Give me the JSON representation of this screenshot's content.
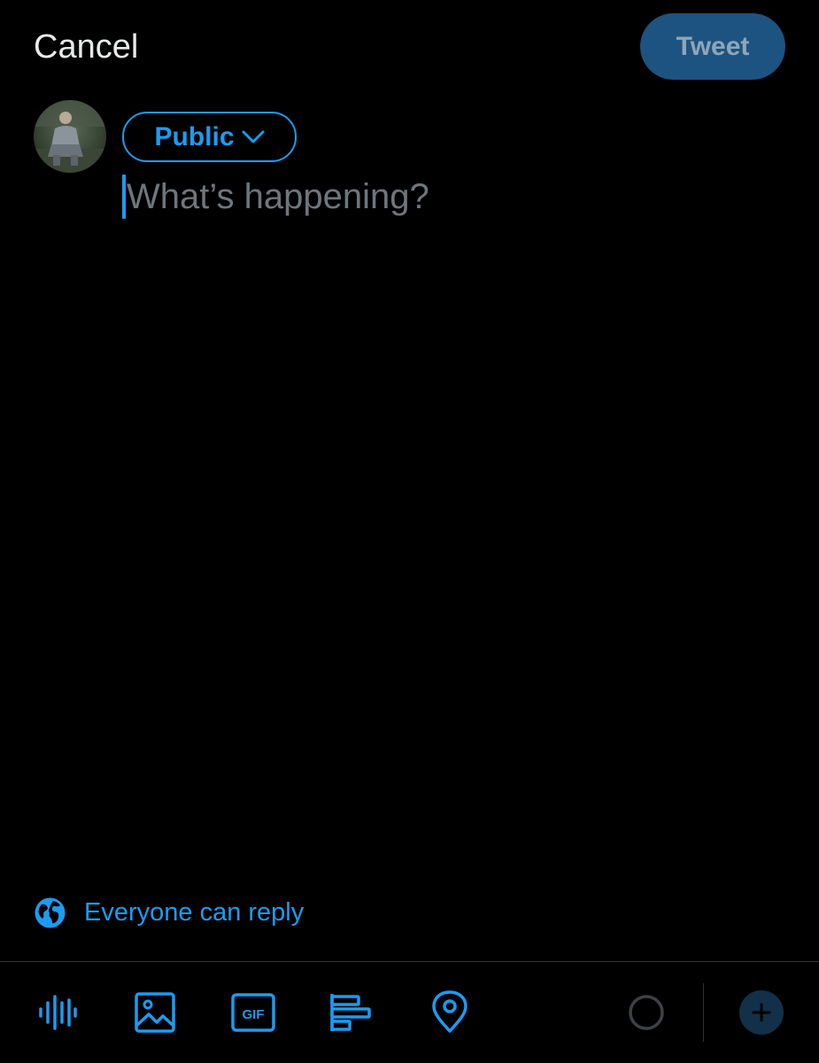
{
  "header": {
    "cancel_label": "Cancel",
    "tweet_label": "Tweet"
  },
  "composer": {
    "audience_label": "Public",
    "placeholder": "What’s happening?",
    "avatar_icon": "user-avatar-photo"
  },
  "reply_setting": {
    "label": "Everyone can reply",
    "icon": "globe-icon"
  },
  "toolbar": {
    "icons": [
      "voice-waveform-icon",
      "image-icon",
      "gif-icon",
      "poll-icon",
      "location-icon",
      "character-progress-ring",
      "add-thread-icon"
    ]
  },
  "colors": {
    "accent": "#1d9bf0",
    "tweet_button_bg": "#1d5380",
    "tweet_button_text": "#8fa6b8",
    "background": "#000000",
    "text": "#e7e9ea",
    "placeholder": "#6e767d",
    "divider": "#2f3336"
  }
}
